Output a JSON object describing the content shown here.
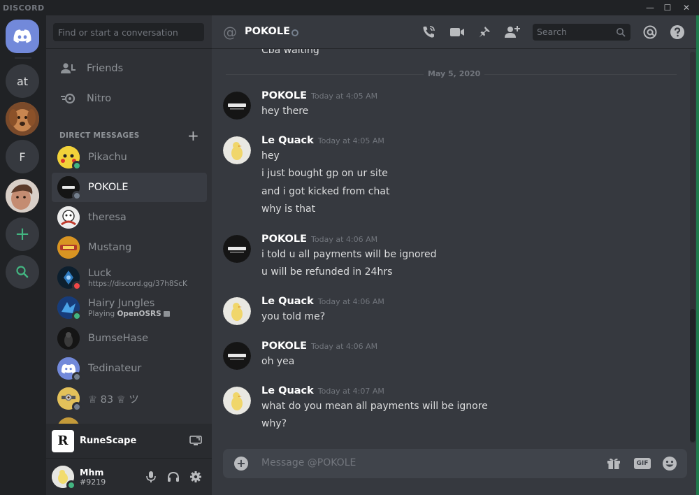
{
  "window": {
    "brand": "DISCORD",
    "controls": {
      "minimize": "—",
      "maximize": "☐",
      "close": "✕"
    }
  },
  "rail": {
    "servers": [
      {
        "id": "home",
        "label": ""
      },
      {
        "id": "at",
        "label": "at"
      },
      {
        "id": "dog",
        "label": ""
      },
      {
        "id": "f",
        "label": "F"
      },
      {
        "id": "face",
        "label": ""
      },
      {
        "id": "add",
        "label": "+"
      },
      {
        "id": "explore",
        "label": ""
      }
    ]
  },
  "sidebar": {
    "search_placeholder": "Find or start a conversation",
    "nav": [
      {
        "label": "Friends",
        "icon": "friends-icon"
      },
      {
        "label": "Nitro",
        "icon": "nitro-icon"
      }
    ],
    "dm_header": "DIRECT MESSAGES",
    "dm_add": "+",
    "dms": [
      {
        "name": "Pikachu",
        "sub": "",
        "status": "online",
        "active": false
      },
      {
        "name": "POKOLE",
        "sub": "",
        "status": "offline",
        "active": true
      },
      {
        "name": "theresa",
        "sub": "",
        "status": "",
        "active": false
      },
      {
        "name": "Mustang",
        "sub": "",
        "status": "",
        "active": false
      },
      {
        "name": "Luck",
        "sub": "https://discord.gg/37h8ScK",
        "status": "dnd",
        "active": false
      },
      {
        "name": "Hairy Jungles",
        "sub_prefix": "Playing",
        "sub_game": "OpenOSRS",
        "status": "online",
        "active": false
      },
      {
        "name": "BumseHase",
        "sub": "",
        "status": "",
        "active": false
      },
      {
        "name": "Tedinateur",
        "sub": "",
        "status": "offline",
        "active": false
      },
      {
        "name": "♕ 83 ♕ ツ",
        "sub": "",
        "status": "offline",
        "active": false
      }
    ],
    "game": {
      "name": "RuneScape",
      "logo_letter": "R"
    },
    "user": {
      "name": "Mhm",
      "tag": "#9219"
    }
  },
  "header": {
    "channel": "POKOLE",
    "search_placeholder": "Search"
  },
  "messages": {
    "cutoff_text": "Cba waiting",
    "date_divider": "May 5, 2020",
    "groups": [
      {
        "author": "POKOLE",
        "time": "Today at 4:05 AM",
        "avatar": "pokole",
        "lines": [
          "hey there"
        ]
      },
      {
        "author": "Le Quack",
        "time": "Today at 4:05 AM",
        "avatar": "quack",
        "lines": [
          "hey",
          "i just bought gp on ur site",
          "and i got kicked from chat",
          "why is that"
        ]
      },
      {
        "author": "POKOLE",
        "time": "Today at 4:06 AM",
        "avatar": "pokole",
        "lines": [
          "i told u all payments will be ignored",
          "u will be refunded in 24hrs"
        ]
      },
      {
        "author": "Le Quack",
        "time": "Today at 4:06 AM",
        "avatar": "quack",
        "lines": [
          "you told me?"
        ]
      },
      {
        "author": "POKOLE",
        "time": "Today at 4:06 AM",
        "avatar": "pokole",
        "lines": [
          "oh yea"
        ]
      },
      {
        "author": "Le Quack",
        "time": "Today at 4:07 AM",
        "avatar": "quack",
        "lines": [
          "what do you mean all payments will be ignore",
          "why?"
        ]
      }
    ]
  },
  "composer": {
    "placeholder": "Message @POKOLE",
    "gif_label": "GIF"
  },
  "colors": {
    "blurple": "#7289da",
    "online": "#43b581",
    "dnd": "#f04747",
    "offline": "#747f8d",
    "bg_main": "#36393f",
    "bg_sidebar": "#2f3136",
    "bg_rail": "#202225"
  }
}
